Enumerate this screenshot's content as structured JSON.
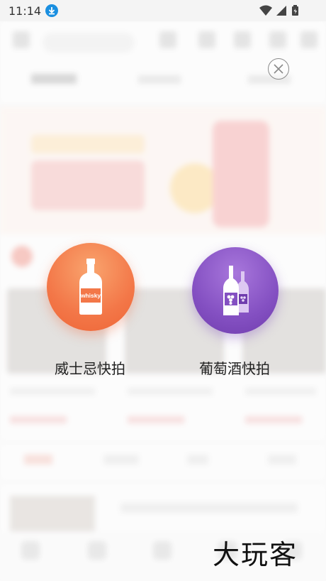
{
  "status_bar": {
    "time": "11:14"
  },
  "options": [
    {
      "label": "威士忌快拍",
      "icon": "whisky-bottle-icon",
      "bottle_text": "whisky",
      "color": "#f37748"
    },
    {
      "label": "葡萄酒快拍",
      "icon": "wine-bottles-icon",
      "color": "#8450c2"
    }
  ],
  "watermark": "大玩客"
}
